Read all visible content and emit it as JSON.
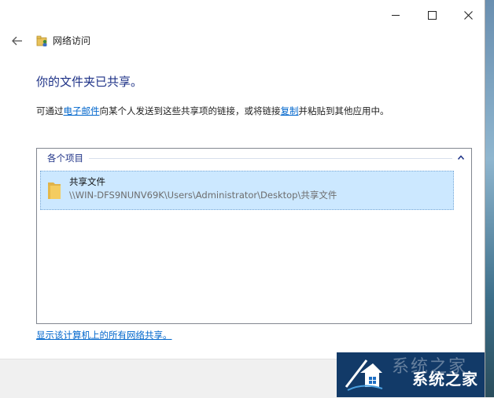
{
  "window": {
    "title": "网络访问",
    "caption_minimize": "minimize-icon",
    "caption_maximize": "maximize-icon",
    "caption_close": "close-icon"
  },
  "nav": {
    "back_icon": "back-arrow-icon",
    "title": "网络访问"
  },
  "main": {
    "heading": "你的文件夹已共享。",
    "desc_part1": "可通过",
    "desc_link1": "电子邮件",
    "desc_part2": "向某个人发送到这些共享项的链接，或将链接",
    "desc_link2": "复制",
    "desc_part3": "并粘贴到其他应用中。"
  },
  "list": {
    "group_label": "各个项目",
    "collapse_icon": "chevron-up-icon",
    "items": [
      {
        "name": "共享文件",
        "path": "\\\\WIN-DFS9NUNV69K\\Users\\Administrator\\Desktop\\共享文件",
        "icon": "folder-icon"
      }
    ]
  },
  "footer": {
    "link": "显示该计算机上的所有网络共享。"
  },
  "watermark": {
    "text": "系统之家",
    "faint_text": "系统之家"
  },
  "colors": {
    "heading": "#1e3287",
    "link": "#0066cc",
    "selection": "#cce8ff"
  }
}
